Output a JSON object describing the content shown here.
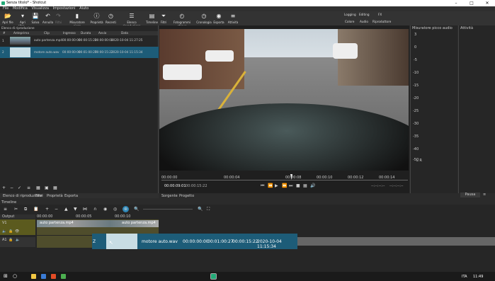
{
  "window": {
    "title": "Senza titolo* - Shotcut",
    "min": "–",
    "max": "□",
    "close": "✕"
  },
  "menu": [
    "File",
    "Modifica",
    "Visualizza",
    "Impostazioni",
    "Aiuto"
  ],
  "toolbar": [
    {
      "label": "Apri file",
      "icon": "folder-open-icon",
      "glyph": "📂"
    },
    {
      "label": "Apri altro...",
      "icon": "open-other-icon",
      "glyph": "▾"
    },
    {
      "label": "Salva",
      "icon": "save-icon",
      "glyph": "💾"
    },
    {
      "label": "Annulla",
      "icon": "undo-icon",
      "glyph": "↶"
    },
    {
      "label": "Rifai",
      "icon": "redo-icon",
      "glyph": "↷"
    },
    {
      "label": "Misuratore picco",
      "icon": "meter-icon",
      "glyph": "▮"
    },
    {
      "label": "Proprietà",
      "icon": "info-icon",
      "glyph": "ⓘ"
    },
    {
      "label": "Recenti",
      "icon": "clock-icon",
      "glyph": "◷"
    },
    {
      "label": "Elenco riproduzione",
      "icon": "list-icon",
      "glyph": "☰"
    },
    {
      "label": "Timeline",
      "icon": "timeline-icon",
      "glyph": "▤"
    },
    {
      "label": "Filtri",
      "icon": "filter-icon",
      "glyph": "⏷"
    },
    {
      "label": "Fotogrammi chiave",
      "icon": "keyframe-icon",
      "glyph": "◴"
    },
    {
      "label": "Cronologia",
      "icon": "history-icon",
      "glyph": "◷"
    },
    {
      "label": "Esporta",
      "icon": "export-icon",
      "glyph": "◉"
    },
    {
      "label": "Attività",
      "icon": "jobs-icon",
      "glyph": "≡"
    }
  ],
  "layouts": {
    "row1": [
      "Logging",
      "Editing",
      "FX"
    ],
    "row2": [
      "Colore",
      "Audio",
      "Riproduttore"
    ]
  },
  "playlist": {
    "title": "Elenco di riproduzione",
    "columns": [
      "#",
      "Anteprima",
      "Clip",
      "Ingresso",
      "Durata",
      "Avvio",
      "Data"
    ],
    "rows": [
      {
        "num": "1",
        "clip": "auto partenza.mp4",
        "in": "00:00:00:00",
        "dur": "00:00:15:22",
        "start": "00:00:00:00",
        "date": "2020-10-04 11:27:25"
      },
      {
        "num": "2",
        "clip": "motore auto.wav",
        "in": "00:00:00:00",
        "dur": "00:01:00:27",
        "start": "00:00:15:22",
        "date": "2020-10-04 11:15:34"
      }
    ],
    "tabs": [
      "Elenco di riproduzione",
      "Filtri",
      "Proprietà",
      "Esporta"
    ]
  },
  "player": {
    "ticks": [
      "00:00:00",
      "00:00:04",
      "00:00:08",
      "00:00:10",
      "00:00:12",
      "00:00:14"
    ],
    "time_current": "00:00:09:01",
    "time_total": "00:00:15:22",
    "dash1": "--:--:--:--",
    "dash2": "--:--:--:--",
    "tabs": [
      "Sorgente",
      "Progetto"
    ]
  },
  "audio_meter": {
    "title": "Misuratore picco audio",
    "scale": [
      "3",
      "0",
      "-5",
      "-10",
      "-15",
      "-20",
      "-25",
      "-30",
      "-35",
      "-40",
      "-50"
    ],
    "lr": "L  R"
  },
  "activity": {
    "title": "Attività",
    "pause": "Pausa"
  },
  "timeline": {
    "title": "Timeline",
    "output": "Output",
    "ruler": [
      "00:00:00",
      "00:00:05",
      "00:00:10"
    ],
    "tracks": [
      {
        "name": "V1"
      },
      {
        "name": "A1"
      }
    ],
    "video_clip_label": "auto partenza.mp4",
    "audio_clip": {
      "name": "motore auto.wav",
      "in": "00:00:00:00",
      "dur": "00:01:00:27",
      "start": "00:00:15:22",
      "date": "2020-10-04 11:15:34"
    },
    "gap_label": "Z"
  },
  "taskbar": {
    "lang": "ITA",
    "time": "11:49"
  }
}
